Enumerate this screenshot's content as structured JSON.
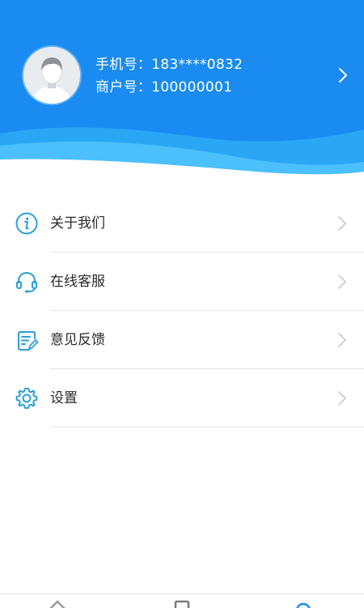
{
  "profile": {
    "phone_label": "手机号：",
    "phone_value": "183****0832",
    "merchant_label": "商户号：",
    "merchant_value": "100000001"
  },
  "menu": [
    {
      "label": "关于我们",
      "icon": "info-icon"
    },
    {
      "label": "在线客服",
      "icon": "headset-icon"
    },
    {
      "label": "意见反馈",
      "icon": "feedback-icon"
    },
    {
      "label": "设置",
      "icon": "gear-icon"
    }
  ],
  "tabbar": {
    "icons": [
      "home-icon",
      "document-icon",
      "user-icon"
    ]
  },
  "colors": {
    "header_blue": "#1a8bf0",
    "wave_light": "#36b6fb",
    "icon_teal": "#2a9fd6",
    "text": "#2a2a2a",
    "chevron": "#c2c2c2"
  }
}
